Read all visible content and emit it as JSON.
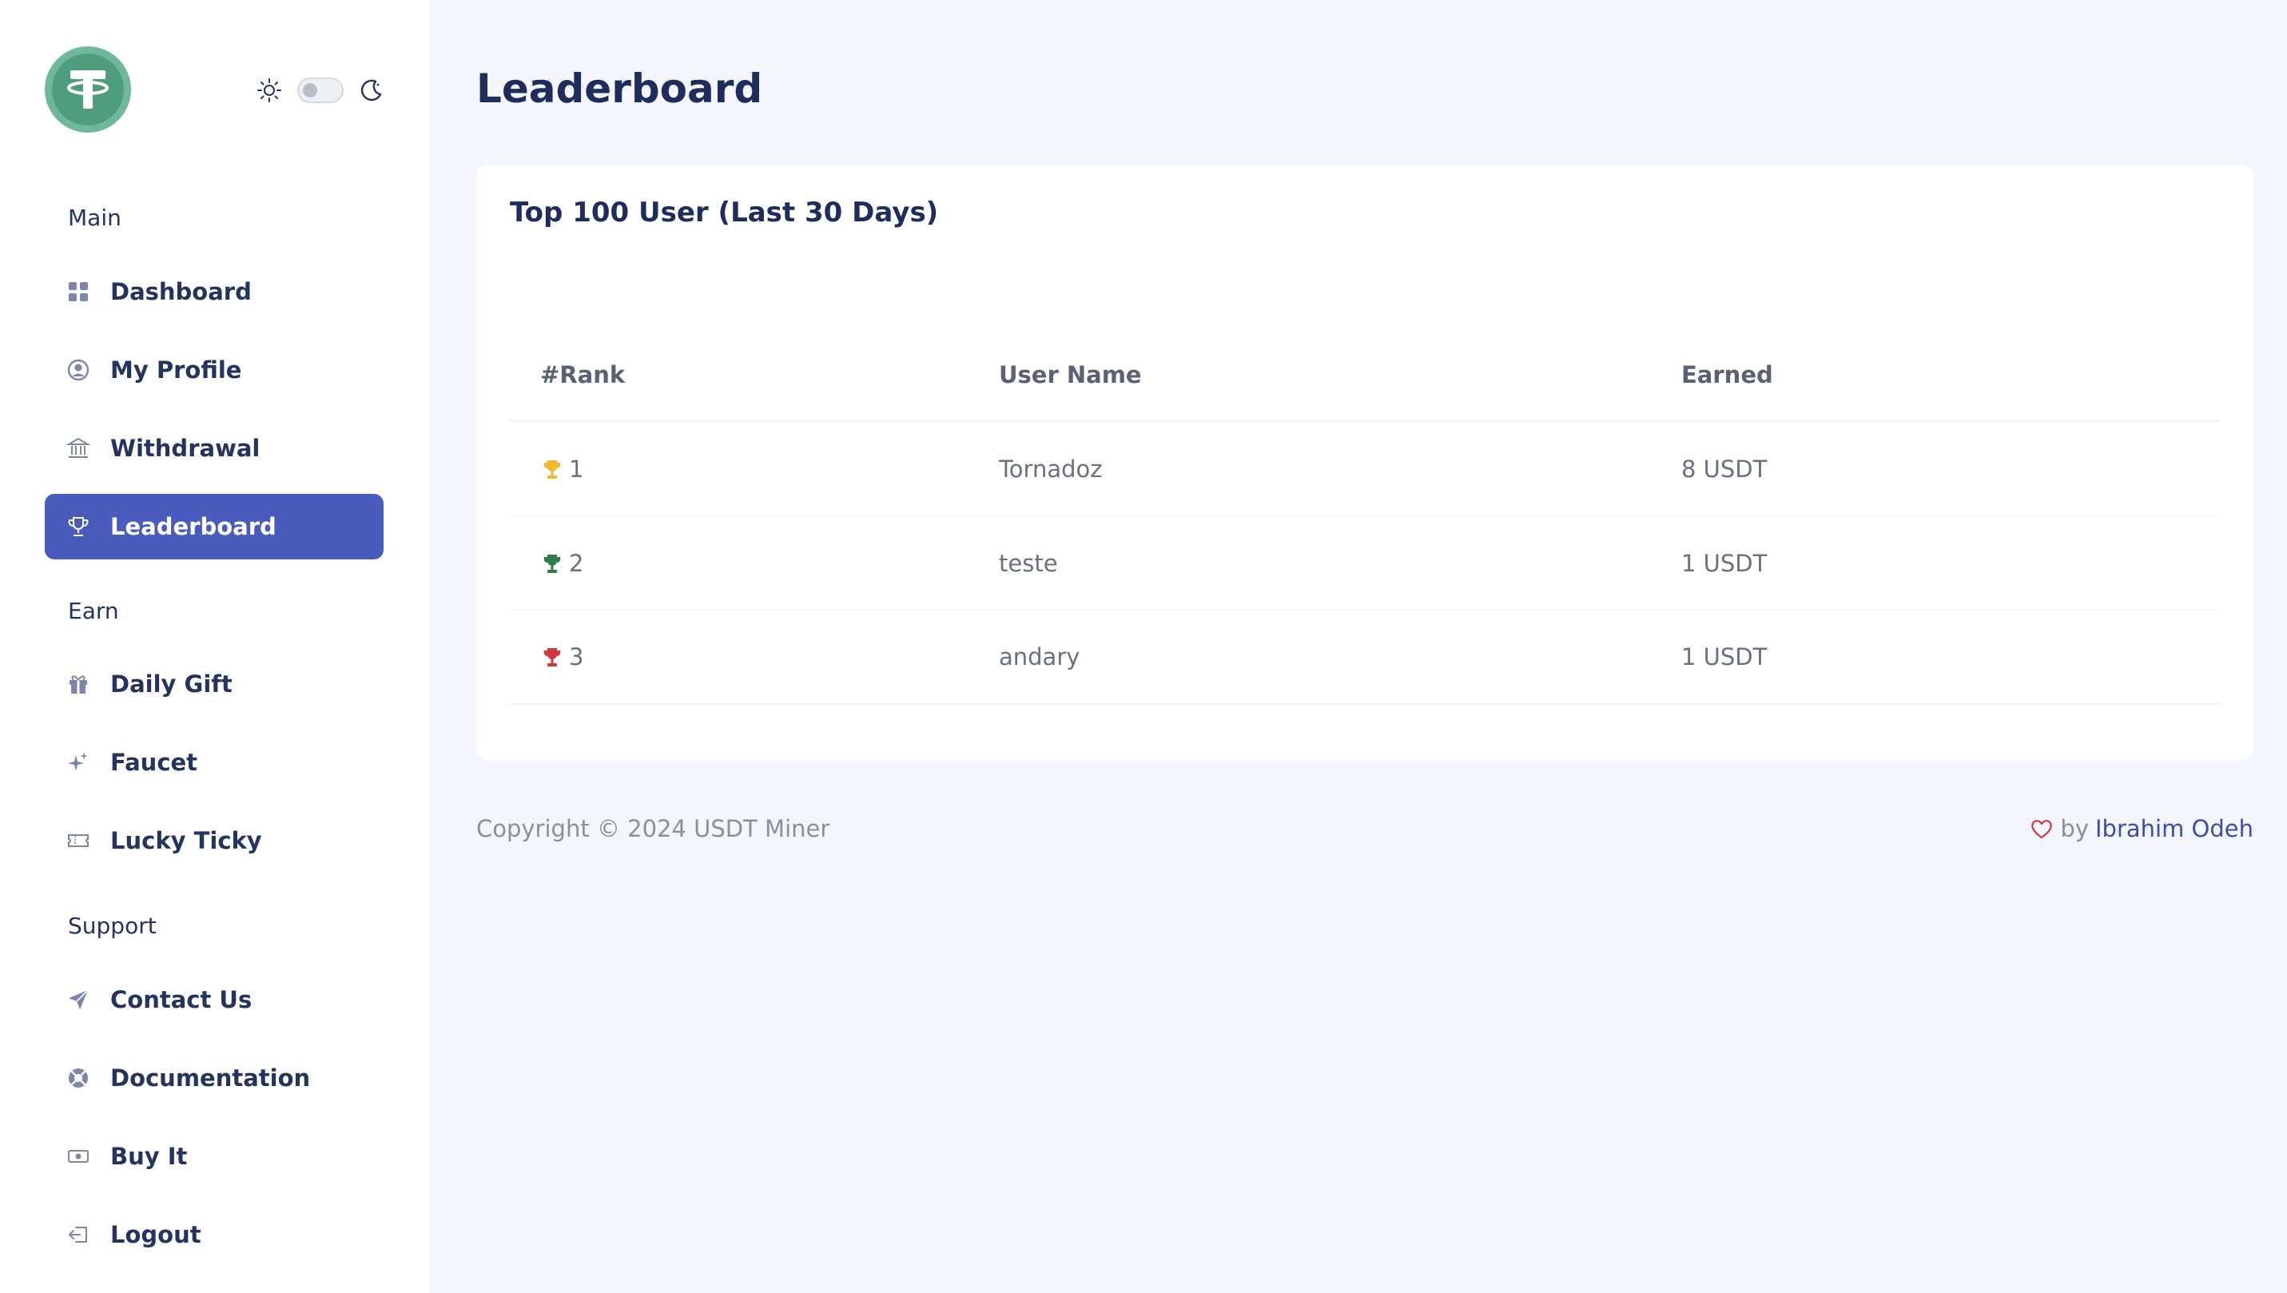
{
  "sidebar": {
    "sections": {
      "main": "Main",
      "earn": "Earn",
      "support": "Support"
    },
    "items": [
      {
        "label": "Dashboard",
        "icon": "grid-icon"
      },
      {
        "label": "My Profile",
        "icon": "user-circle-icon"
      },
      {
        "label": "Withdrawal",
        "icon": "bank-icon"
      },
      {
        "label": "Leaderboard",
        "icon": "trophy-icon",
        "active": true
      },
      {
        "label": "Daily Gift",
        "icon": "gift-icon"
      },
      {
        "label": "Faucet",
        "icon": "sparkles-icon"
      },
      {
        "label": "Lucky Ticky",
        "icon": "ticket-icon"
      },
      {
        "label": "Contact Us",
        "icon": "paper-plane-icon"
      },
      {
        "label": "Documentation",
        "icon": "lifebuoy-icon"
      },
      {
        "label": "Buy It",
        "icon": "cash-icon"
      },
      {
        "label": "Logout",
        "icon": "logout-icon"
      }
    ]
  },
  "page": {
    "title": "Leaderboard"
  },
  "card": {
    "title": "Top 100 User (Last 30 Days)"
  },
  "table": {
    "headers": [
      "#Rank",
      "User Name",
      "Earned"
    ],
    "rows": [
      {
        "rank": "1",
        "user": "Tornadoz",
        "earned": "8 USDT",
        "trophy_color": "#f3b92b"
      },
      {
        "rank": "2",
        "user": "teste",
        "earned": "1 USDT",
        "trophy_color": "#2e7d4a"
      },
      {
        "rank": "3",
        "user": "andary",
        "earned": "1 USDT",
        "trophy_color": "#d0383f"
      }
    ]
  },
  "footer": {
    "copyright": "Copyright © 2024 USDT Miner",
    "by": "by",
    "author": "Ibrahim Odeh"
  },
  "colors": {
    "accent": "#4b5bbd",
    "logo": "#4e9e7d",
    "heart": "#d0383f"
  }
}
